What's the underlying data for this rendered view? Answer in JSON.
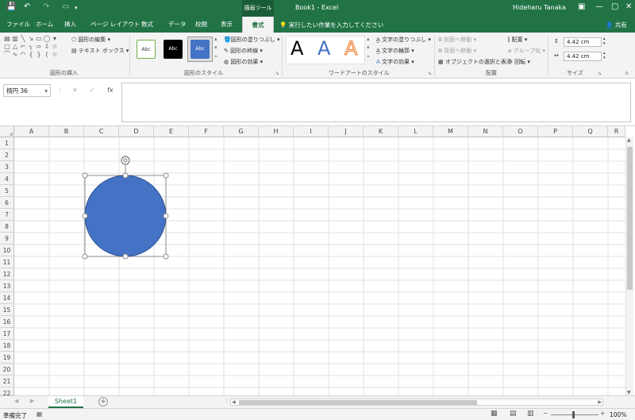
{
  "titlebar": {
    "save_icon": "save-icon",
    "undo_icon": "undo-icon",
    "redo_icon": "redo-icon",
    "context_tab": "描画ツール",
    "window_title": "Book1  -  Excel",
    "user": "Hideharu Tanaka",
    "ribbon_display_icon": "ribbon-display-icon",
    "minimize_icon": "minimize-icon",
    "restore_icon": "restore-icon",
    "close_icon": "close-icon",
    "accent": "#217346"
  },
  "tabs": [
    "ファイル",
    "ホーム",
    "挿入",
    "ページ レイアウト",
    "数式",
    "データ",
    "校閲",
    "表示",
    "書式"
  ],
  "active_tab": "書式",
  "tellme": "実行したい作業を入力してください",
  "share": "共有",
  "ribbon": {
    "insert_shapes": {
      "label": "図形の挿入",
      "edit_shape": "図形の編集",
      "text_box": "テキスト ボックス"
    },
    "shape_styles": {
      "label": "図形のスタイル",
      "samples": [
        "Abc",
        "Abc",
        "Abc"
      ],
      "fill": "図形の塗りつぶし",
      "outline": "図形の枠線",
      "effects": "図形の効果"
    },
    "wordart": {
      "label": "ワードアートのスタイル",
      "letters": [
        "A",
        "A",
        "A"
      ],
      "text_fill": "文字の塗りつぶし",
      "text_outline": "文字の輪郭",
      "text_effects": "文字の効果"
    },
    "arrange": {
      "label": "配置",
      "bring_forward": "前面へ移動",
      "send_backward": "背面へ移動",
      "selection_pane": "オブジェクトの選択と表示",
      "align": "配置",
      "group": "グループ化",
      "rotate": "回転"
    },
    "size": {
      "label": "サイズ",
      "height": "4.42 cm",
      "width": "4.42 cm"
    }
  },
  "formula_bar": {
    "name_box": "楕円 36",
    "cancel": "✕",
    "enter": "✓",
    "fx": "fx",
    "value": ""
  },
  "sheet": {
    "columns": [
      "A",
      "B",
      "C",
      "D",
      "E",
      "F",
      "G",
      "H",
      "I",
      "J",
      "K",
      "L",
      "M",
      "N",
      "O",
      "P",
      "Q",
      "R"
    ],
    "rows": [
      "1",
      "2",
      "3",
      "4",
      "5",
      "6",
      "7",
      "8",
      "9",
      "10",
      "11",
      "12",
      "13",
      "14",
      "15",
      "16",
      "17",
      "18",
      "19",
      "20",
      "21",
      "22"
    ],
    "shape_fill": "#4472c4"
  },
  "sheet_tabs": {
    "tabs": [
      "Sheet1"
    ],
    "add_icon": "add-sheet-icon"
  },
  "statusbar": {
    "ready": "準備完了",
    "zoom": "100%",
    "zoom_minus": "−",
    "zoom_plus": "+"
  }
}
